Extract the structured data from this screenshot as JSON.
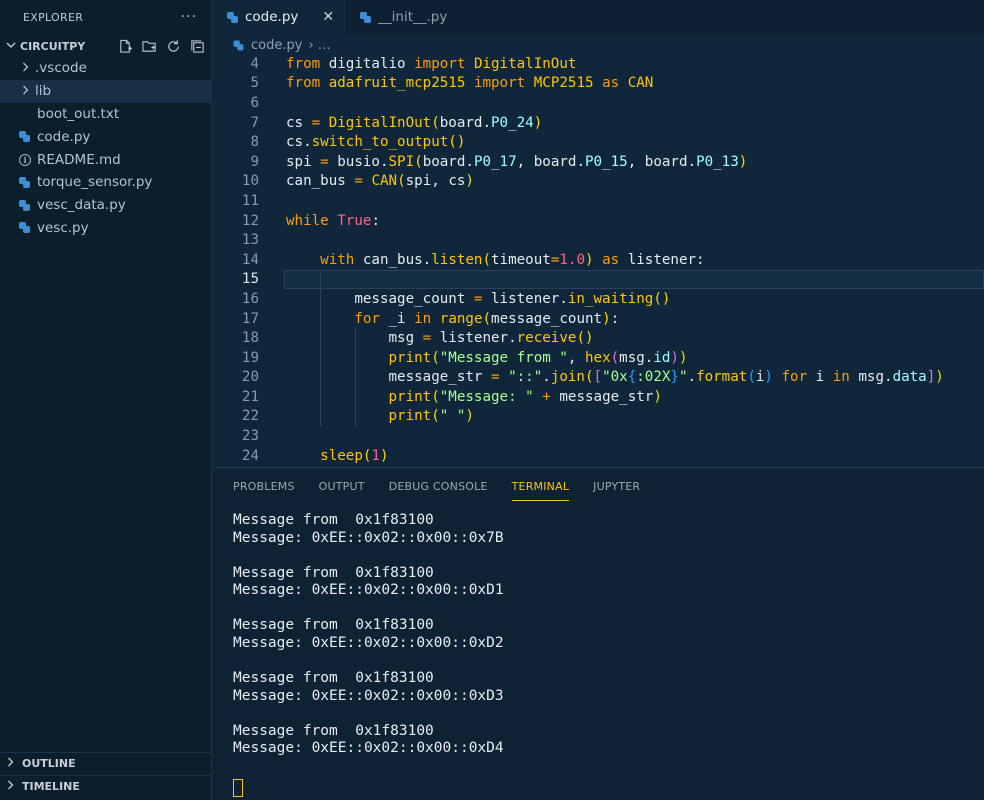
{
  "explorer": {
    "title": "EXPLORER",
    "more": "···",
    "folder": "CIRCUITPY",
    "items": [
      {
        "label": ".vscode",
        "type": "folder"
      },
      {
        "label": "lib",
        "type": "folder"
      },
      {
        "label": "boot_out.txt",
        "type": "text"
      },
      {
        "label": "code.py",
        "type": "python"
      },
      {
        "label": "README.md",
        "type": "info"
      },
      {
        "label": "torque_sensor.py",
        "type": "python"
      },
      {
        "label": "vesc_data.py",
        "type": "python"
      },
      {
        "label": "vesc.py",
        "type": "python"
      }
    ],
    "outline": "OUTLINE",
    "timeline": "TIMELINE"
  },
  "tabs": [
    {
      "label": "code.py",
      "active": true
    },
    {
      "label": "__init__.py",
      "active": false
    }
  ],
  "breadcrumb": {
    "file": "code.py",
    "rest": "› …"
  },
  "code": {
    "line_numbers": [
      "4",
      "5",
      "6",
      "7",
      "8",
      "9",
      "10",
      "11",
      "12",
      "13",
      "14",
      "15",
      "16",
      "17",
      "18",
      "19",
      "20",
      "21",
      "22",
      "23",
      "24"
    ],
    "current_line": "15"
  },
  "panel": {
    "tabs": [
      "PROBLEMS",
      "OUTPUT",
      "DEBUG CONSOLE",
      "TERMINAL",
      "JUPYTER"
    ],
    "active_tab": "TERMINAL",
    "terminal_lines": [
      "Message from  0x1f83100",
      "Message: 0xEE::0x02::0x00::0x7B",
      "",
      "Message from  0x1f83100",
      "Message: 0xEE::0x02::0x00::0xD1",
      "",
      "Message from  0x1f83100",
      "Message: 0xEE::0x02::0x00::0xD2",
      "",
      "Message from  0x1f83100",
      "Message: 0xEE::0x02::0x00::0xD3",
      "",
      "Message from  0x1f83100",
      "Message: 0xEE::0x02::0x00::0xD4"
    ]
  },
  "colors": {
    "keyword": "#ff9d00",
    "function": "#ffc600",
    "attribute": "#9effff",
    "string": "#a5ff90",
    "number": "#ff628c",
    "accent": "#ffc600"
  }
}
